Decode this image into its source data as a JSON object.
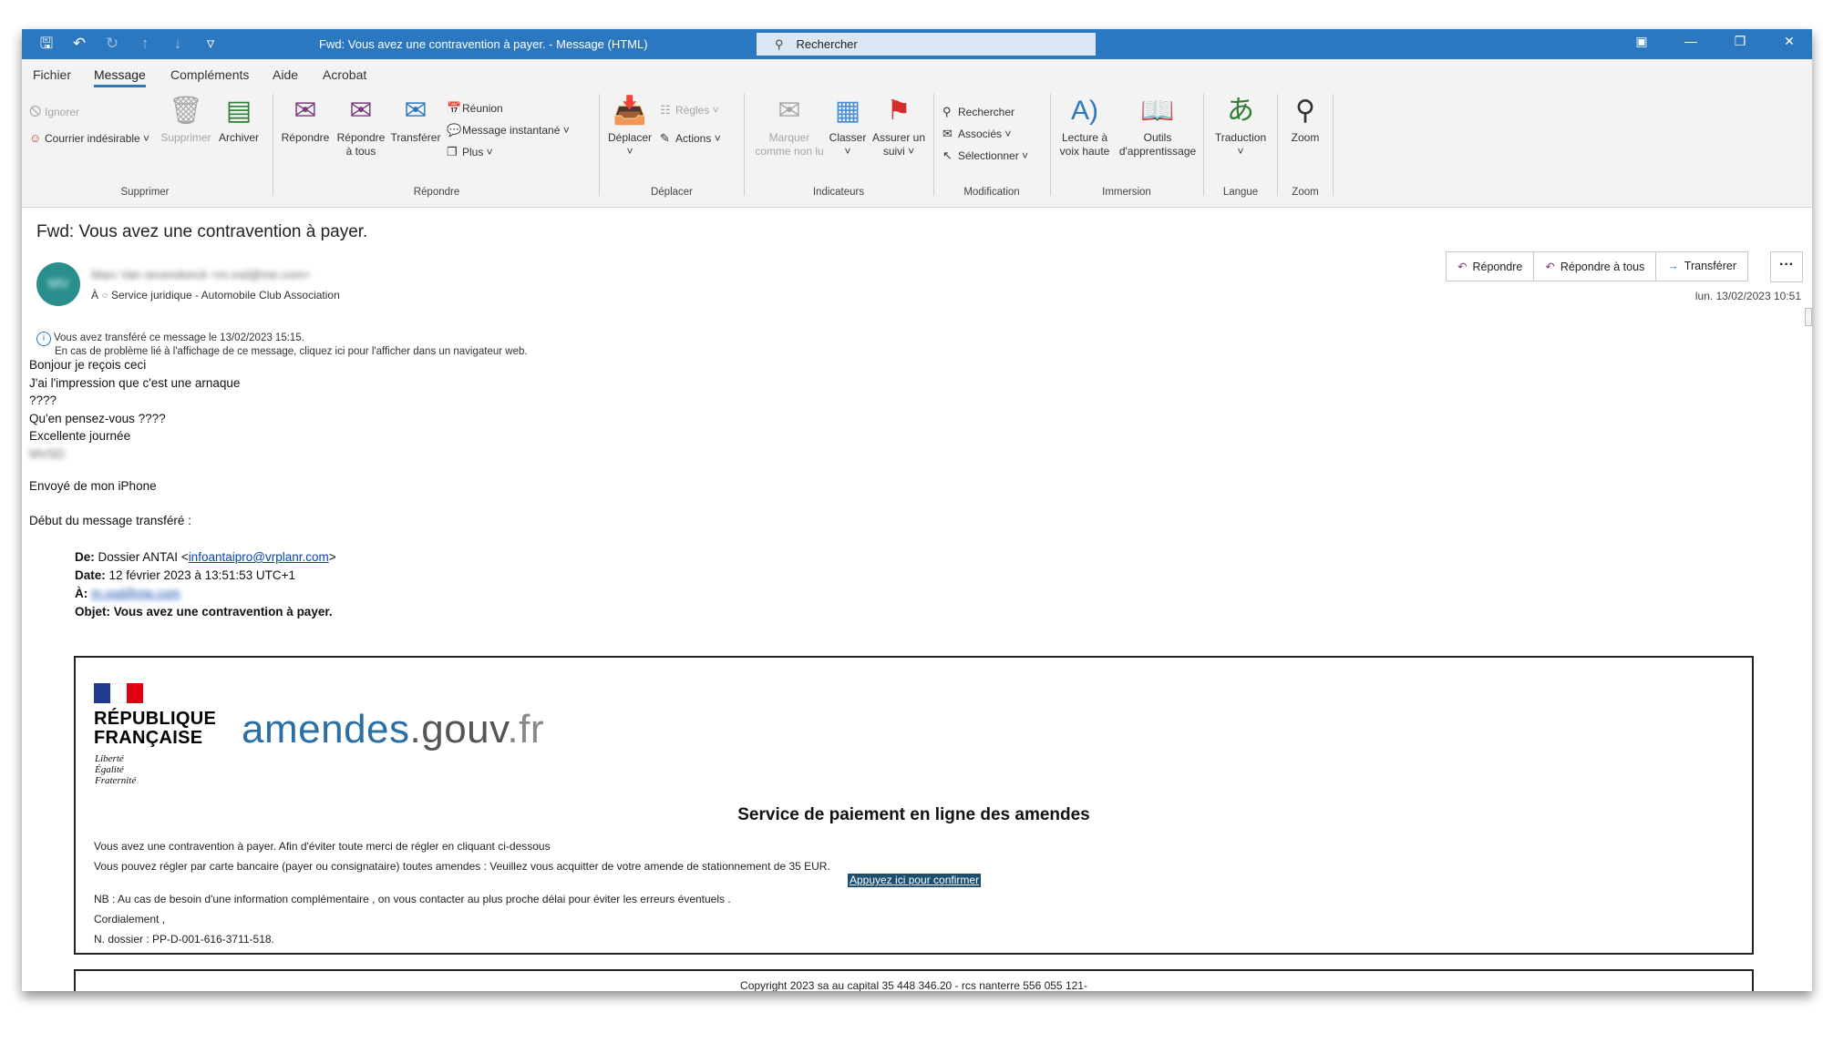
{
  "window": {
    "title": "Fwd: Vous avez une contravention à payer.  -  Message (HTML)",
    "search_placeholder": "Rechercher"
  },
  "menu": {
    "items": [
      "Fichier",
      "Message",
      "Compléments",
      "Aide",
      "Acrobat"
    ],
    "active": "Message"
  },
  "ribbon": {
    "supprimer": {
      "label": "Supprimer",
      "ignorer": "Ignorer",
      "courrier_indesirable": "Courrier indésirable",
      "supprimer_btn": "Supprimer",
      "archiver": "Archiver"
    },
    "repondre": {
      "label": "Répondre",
      "repondre_btn": "Répondre",
      "repondre_tous_1": "Répondre",
      "repondre_tous_2": "à tous",
      "transferer": "Transférer",
      "reunion": "Réunion",
      "message_instantane": "Message instantané",
      "plus": "Plus"
    },
    "deplacer": {
      "label": "Déplacer",
      "deplacer_btn": "Déplacer",
      "regles": "Règles",
      "actions": "Actions"
    },
    "indicateurs": {
      "label": "Indicateurs",
      "marquer_1": "Marquer",
      "marquer_2": "comme non lu",
      "classer": "Classer",
      "assurer_1": "Assurer un",
      "assurer_2": "suivi"
    },
    "modification": {
      "label": "Modification",
      "rechercher": "Rechercher",
      "associes": "Associés",
      "selectionner": "Sélectionner"
    },
    "immersion": {
      "label": "Immersion",
      "lecture_1": "Lecture à",
      "lecture_2": "voix haute",
      "outils_1": "Outils",
      "outils_2": "d'apprentissage"
    },
    "langue": {
      "label": "Langue",
      "traduction": "Traduction"
    },
    "zoom": {
      "label": "Zoom",
      "zoom_btn": "Zoom"
    }
  },
  "message": {
    "subject": "Fwd: Vous avez une contravention à payer.",
    "avatar_initials": "MV",
    "sender": "Marc Van sevendonck <m.vsd@me.com>",
    "to_label": "À",
    "recipient": "Service juridique - Automobile Club Association",
    "actions": {
      "reply": "Répondre",
      "reply_all": "Répondre à tous",
      "forward": "Transférer",
      "more": "···"
    },
    "datetime": "lun. 13/02/2023 10:51",
    "info_line1": "Vous avez transféré ce message le 13/02/2023 15:15.",
    "info_line2": "En cas de problème lié à l'affichage de ce message, cliquez ici pour l'afficher dans un navigateur web.",
    "body": {
      "l1": "Bonjour je reçois ceci",
      "l2": "J'ai l'impression que c'est une arnaque",
      "l3": "????",
      "l4": "Qu'en pensez-vous ????",
      "l5": "Excellente journée",
      "l6": "MVSD",
      "l7": "Envoyé de mon iPhone",
      "l8": "Début du message transféré :"
    },
    "forwarded": {
      "from_label": "De:",
      "from_name": "Dossier ANTAI <",
      "from_email": "infoantaipro@vrplanr.com",
      "from_close": ">",
      "date_label": "Date:",
      "date": "12 février 2023 à 13:51:53 UTC+1",
      "to_label": "À:",
      "to": "m.vsd@me.com",
      "subject_label": "Objet:",
      "subject": "Vous avez une contravention à payer."
    }
  },
  "phish": {
    "rf_line1": "RÉPUBLIQUE",
    "rf_line2": "FRANÇAISE",
    "devise1": "Liberté",
    "devise2": "Égalité",
    "devise3": "Fraternité",
    "brand1": "amendes",
    "brand2": ".gouv",
    "brand3": ".fr",
    "title": "Service de paiement en ligne des amendes",
    "line1": "Vous avez une contravention à payer. Afin d'éviter toute merci de régler en cliquant ci-dessous",
    "line2": "Vous pouvez régler par carte bancaire (payer ou consignataire) toutes amendes : Veuillez vous acquitter de votre amende de stationnement de 35 EUR.",
    "confirm": "Appuyez ici pour confirmer",
    "line3": "NB : Au cas de besoin d'une information complémentaire , on vous contacter au plus proche délai pour éviter les erreurs éventuels .",
    "line4": "Cordialement ,",
    "line5": "N. dossier : PP-D-001-616-3711-518.",
    "copyright": "Copyright 2023 sa au capital 35 448 346.20 - rcs nanterre 556 055 121-"
  },
  "colors": {
    "titlebar": "#2b78c0",
    "avatar": "#2a8f8c",
    "confirm_bg": "#1c4e6e",
    "brand_blue": "#2a6fa6"
  }
}
